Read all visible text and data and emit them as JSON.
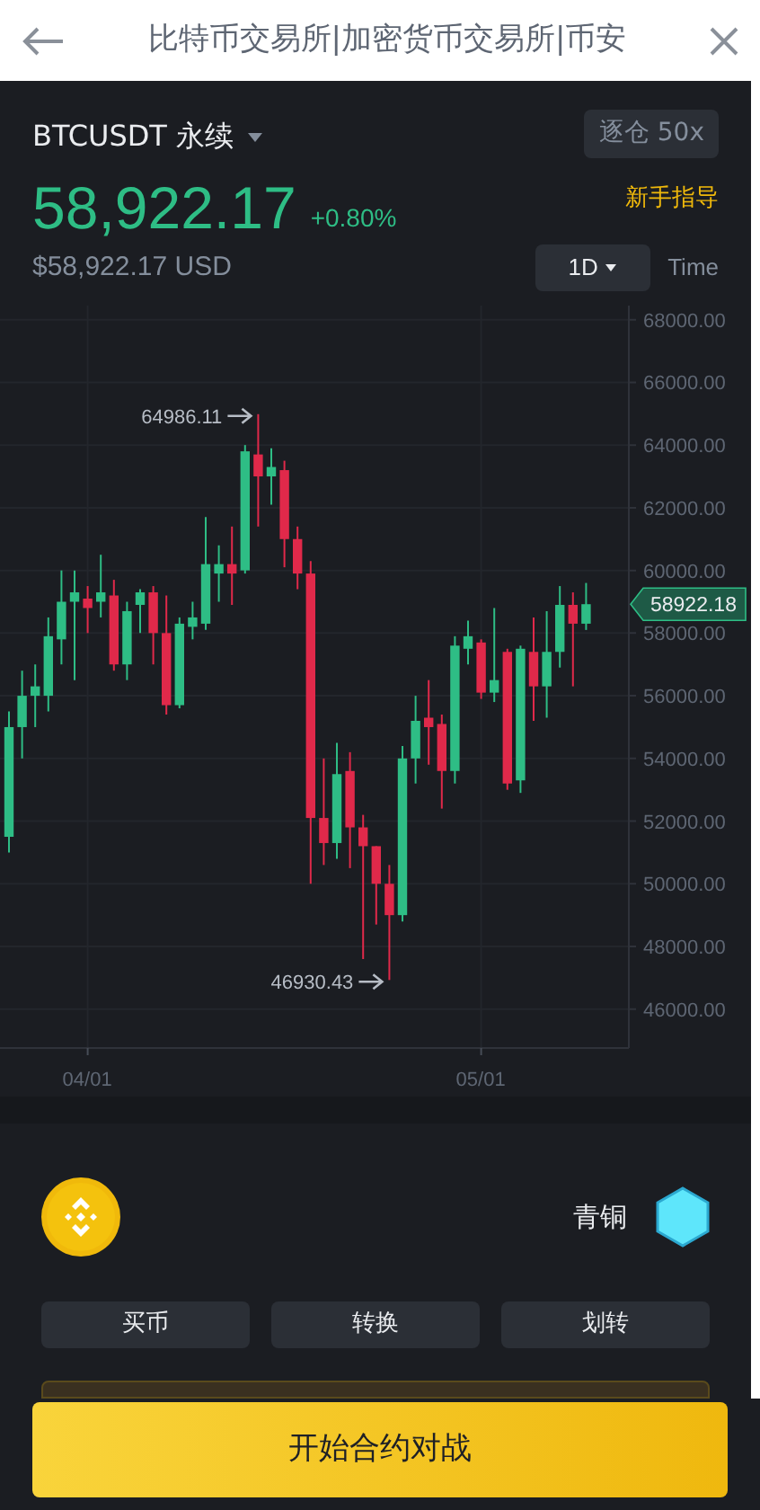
{
  "header": {
    "title": "比特币交易所|加密货币交易所|币安"
  },
  "market": {
    "symbol": "BTCUSDT 永续",
    "margin": "逐仓 50x",
    "price": "58,922.17",
    "change": "+0.80%",
    "usd": "$58,922.17 USD",
    "guide": "新手指导",
    "interval": "1D",
    "time_label": "Time"
  },
  "chart": {
    "last_price": "58922.18",
    "chart_data": {
      "type": "candlestick",
      "categories": [
        null,
        null,
        null,
        null,
        null,
        null,
        "04/01",
        null,
        null,
        null,
        null,
        null,
        null,
        null,
        null,
        null,
        null,
        null,
        null,
        null,
        null,
        null,
        null,
        null,
        null,
        null,
        null,
        null,
        null,
        null,
        null,
        null,
        null,
        null,
        null,
        null,
        "05/01",
        null,
        null,
        null,
        null,
        null,
        null,
        null,
        null
      ],
      "ohlc": [
        [
          51500,
          55500,
          51000,
          55000
        ],
        [
          55000,
          56800,
          54000,
          56000
        ],
        [
          56000,
          57000,
          55000,
          56300
        ],
        [
          56000,
          58500,
          55500,
          57900
        ],
        [
          57800,
          60000,
          57000,
          59000
        ],
        [
          59000,
          60000,
          56500,
          59300
        ],
        [
          59100,
          59500,
          58000,
          58800
        ],
        [
          59000,
          60500,
          58500,
          59300
        ],
        [
          59200,
          59700,
          56800,
          57000
        ],
        [
          57000,
          59000,
          56500,
          58700
        ],
        [
          58900,
          59400,
          58000,
          59300
        ],
        [
          59300,
          59500,
          57000,
          58000
        ],
        [
          58000,
          59200,
          55400,
          55700
        ],
        [
          55700,
          58500,
          55600,
          58300
        ],
        [
          58200,
          59000,
          57800,
          58500
        ],
        [
          58300,
          61700,
          58100,
          60200
        ],
        [
          59900,
          60800,
          59000,
          60200
        ],
        [
          60200,
          61400,
          58900,
          59900
        ],
        [
          60000,
          64000,
          59900,
          63800
        ],
        [
          63700,
          64986.11,
          61400,
          63000
        ],
        [
          63000,
          63900,
          62100,
          63300
        ],
        [
          63200,
          63500,
          60100,
          61000
        ],
        [
          61000,
          61400,
          59400,
          59900
        ],
        [
          59900,
          60300,
          50000,
          52100
        ],
        [
          52100,
          54000,
          50600,
          51300
        ],
        [
          51300,
          54500,
          50800,
          53500
        ],
        [
          53600,
          54200,
          50500,
          51800
        ],
        [
          51800,
          52200,
          47600,
          51200
        ],
        [
          51200,
          51200,
          48700,
          50000
        ],
        [
          50000,
          50600,
          46930.43,
          49000
        ],
        [
          49000,
          54400,
          48800,
          54000
        ],
        [
          54000,
          56000,
          53200,
          55200
        ],
        [
          55300,
          56500,
          53800,
          55000
        ],
        [
          55100,
          55400,
          52400,
          53600
        ],
        [
          53600,
          57900,
          53200,
          57600
        ],
        [
          57500,
          58400,
          57000,
          57900
        ],
        [
          57700,
          57800,
          55900,
          56100
        ],
        [
          56100,
          58800,
          55800,
          56500
        ],
        [
          57400,
          57500,
          53000,
          53200
        ],
        [
          53300,
          57600,
          52900,
          57500
        ],
        [
          57400,
          58500,
          55200,
          56300
        ],
        [
          56300,
          58700,
          55300,
          57400
        ],
        [
          57400,
          59500,
          56900,
          58900
        ],
        [
          58900,
          59300,
          56300,
          58300
        ],
        [
          58300,
          59600,
          58100,
          58922.18
        ]
      ],
      "ylim": [
        44760,
        68450
      ],
      "yticks": [
        {
          "value": 68000,
          "label": "68000.00"
        },
        {
          "value": 66000,
          "label": "66000.00"
        },
        {
          "value": 64000,
          "label": "64000.00"
        },
        {
          "value": 62000,
          "label": "62000.00"
        },
        {
          "value": 60000,
          "label": "60000.00"
        },
        {
          "value": 58000,
          "label": "58000.00"
        },
        {
          "value": 56000,
          "label": "56000.00"
        },
        {
          "value": 54000,
          "label": "54000.00"
        },
        {
          "value": 52000,
          "label": "52000.00"
        },
        {
          "value": 50000,
          "label": "50000.00"
        },
        {
          "value": 48000,
          "label": "48000.00"
        },
        {
          "value": 46000,
          "label": "46000.00"
        }
      ],
      "grid": true,
      "annotations": [
        "64986.11",
        "46930.43"
      ]
    }
  },
  "rank": {
    "label": "青铜"
  },
  "actions": [
    "买币",
    "转换",
    "划转"
  ],
  "start_button": "开始合约对战"
}
